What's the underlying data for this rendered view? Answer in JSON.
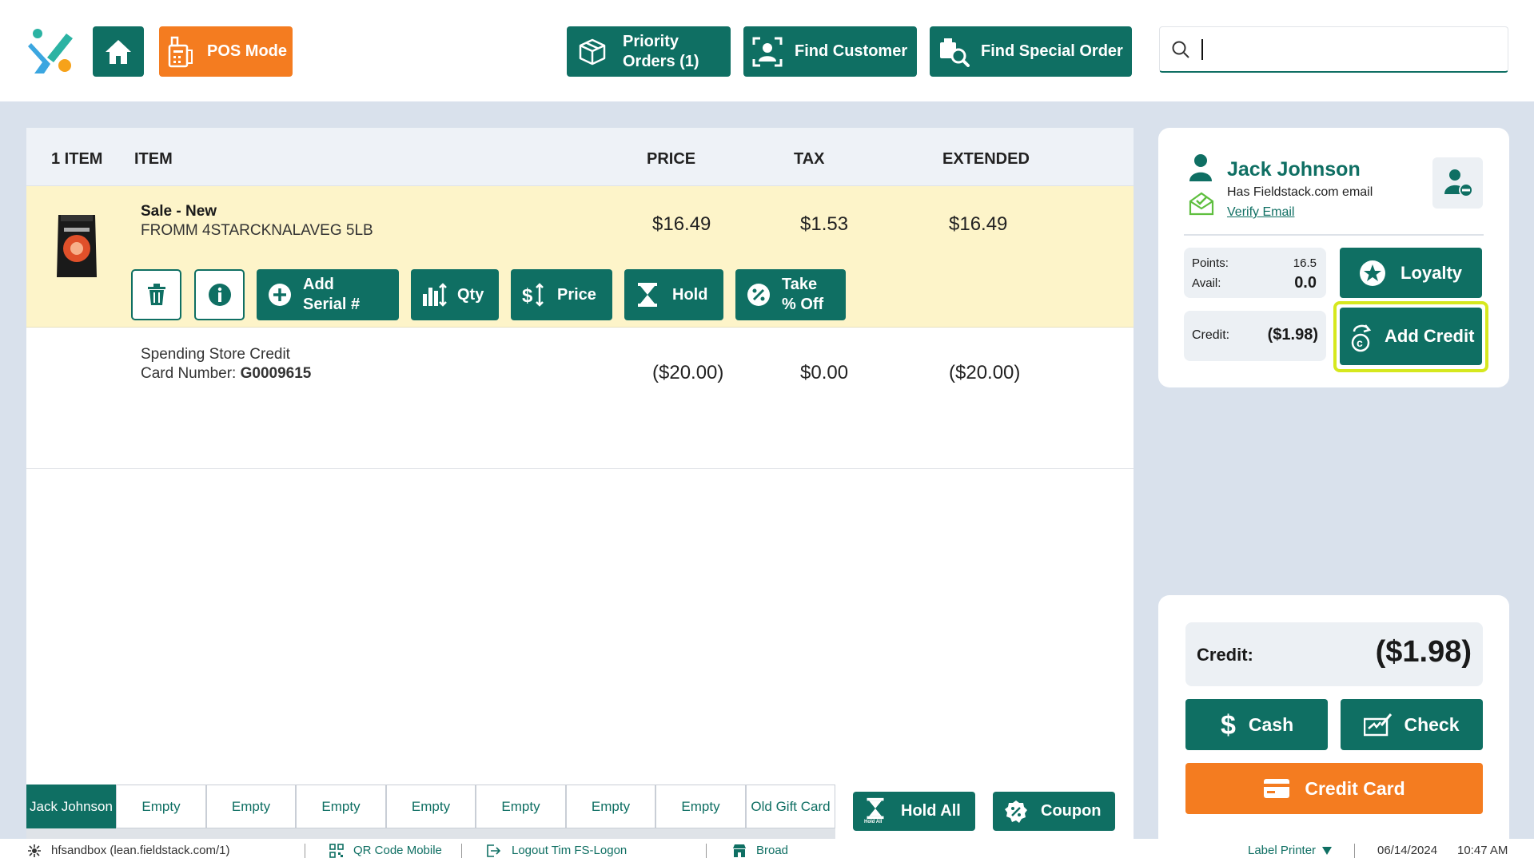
{
  "topbar": {
    "pos_mode": "POS Mode",
    "priority_orders_line1": "Priority",
    "priority_orders_line2": "Orders (1)",
    "find_customer": "Find Customer",
    "find_special_order": "Find Special Order",
    "search_value": "",
    "search_placeholder": ""
  },
  "cart": {
    "headers": {
      "count": "1 ITEM",
      "item": "ITEM",
      "price": "PRICE",
      "tax": "TAX",
      "extended": "EXTENDED"
    },
    "lines": [
      {
        "title": "Sale - New",
        "desc": "FROMM 4STARCKNALAVEG 5LB",
        "price": "$16.49",
        "tax": "$1.53",
        "extended": "$16.49"
      },
      {
        "title": "Spending Store Credit",
        "card_label": "Card Number:",
        "card_number": "G0009615",
        "price": "($20.00)",
        "tax": "$0.00",
        "extended": "($20.00)"
      }
    ],
    "line_actions": {
      "add_serial_1": "Add",
      "add_serial_2": "Serial #",
      "qty": "Qty",
      "price": "Price",
      "hold": "Hold",
      "take_off_1": "Take",
      "take_off_2": "% Off"
    }
  },
  "tabs": [
    "Jack Johnson",
    "Empty",
    "Empty",
    "Empty",
    "Empty",
    "Empty",
    "Empty",
    "Empty",
    "Old Gift Card"
  ],
  "hold_all": "Hold All",
  "hold_all_icon_caption": "Hold All",
  "coupon": "Coupon",
  "customer": {
    "name": "Jack Johnson",
    "email_note": "Has Fieldstack.com email",
    "verify_link": "Verify Email",
    "points_label": "Points:",
    "points_value": "16.5",
    "avail_label": "Avail:",
    "avail_value": "0.0",
    "loyalty_label": "Loyalty",
    "credit_label": "Credit:",
    "credit_value": "($1.98)",
    "add_credit_label": "Add Credit"
  },
  "payment": {
    "credit_label": "Credit:",
    "credit_value": "($1.98)",
    "cash": "Cash",
    "check": "Check",
    "credit_card": "Credit Card"
  },
  "status": {
    "host": "hfsandbox (lean.fieldstack.com/1)",
    "qr": "QR Code Mobile",
    "logout": "Logout Tim FS-Logon",
    "store": "Broad",
    "printer": "Label Printer",
    "date": "06/14/2024",
    "time": "10:47 AM"
  },
  "colors": {
    "teal": "#0f6f63",
    "orange": "#f47c20",
    "highlight_row": "#fdf4c9",
    "focus_ring": "#d6e81e",
    "background": "#d9e1ec"
  }
}
